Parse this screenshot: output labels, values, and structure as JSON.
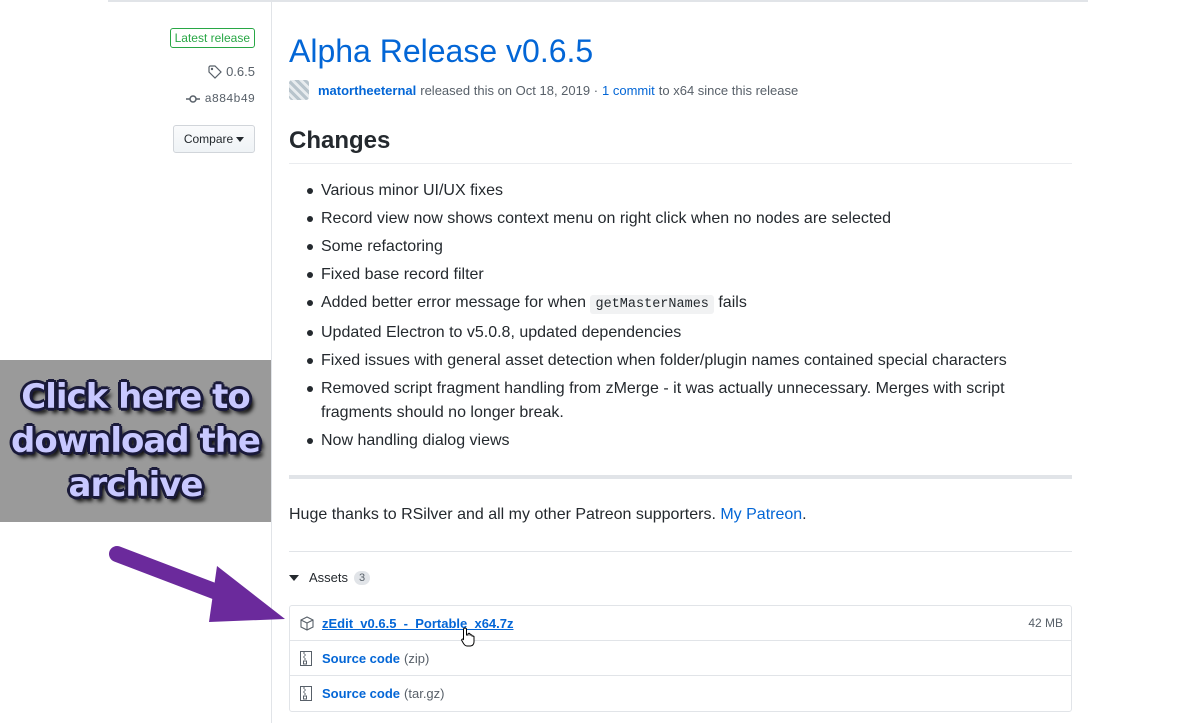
{
  "sidebar": {
    "badge": "Latest release",
    "tag": "0.6.5",
    "commit": "a884b49",
    "compare_label": "Compare"
  },
  "release": {
    "title": "Alpha Release v0.6.5",
    "author": "matortheeternal",
    "released_text": "released this on Oct 18, 2019 ·",
    "commits_link": "1 commit",
    "since_text": "to x64 since this release"
  },
  "changes": {
    "heading": "Changes",
    "items": [
      {
        "text": "Various minor UI/UX fixes"
      },
      {
        "text": "Record view now shows context menu on right click when no nodes are selected"
      },
      {
        "text": "Some refactoring"
      },
      {
        "text": "Fixed base record filter"
      },
      {
        "pre": "Added better error message for when",
        "code": "getMasterNames",
        "post": "fails"
      },
      {
        "text": "Updated Electron to v5.0.8, updated dependencies"
      },
      {
        "text": "Fixed issues with general asset detection when folder/plugin names contained special characters"
      },
      {
        "text": "Removed script fragment handling from zMerge - it was actually unnecessary. Merges with script fragments should no longer break."
      },
      {
        "text": "Now handling dialog views"
      }
    ]
  },
  "thanks": {
    "text": "Huge thanks to RSilver and all my other Patreon supporters.",
    "link": "My Patreon",
    "suffix": "."
  },
  "assets": {
    "label": "Assets",
    "count": "3",
    "items": [
      {
        "name": "zEdit_v0.6.5_-_Portable_x64.7z",
        "size": "42 MB",
        "icon": "package-icon"
      },
      {
        "name": "Source code",
        "format": "(zip)",
        "icon": "file-zip-icon"
      },
      {
        "name": "Source code",
        "format": "(tar.gz)",
        "icon": "file-zip-icon"
      }
    ]
  },
  "overlay": {
    "line1": "Click here to",
    "line2": "download the",
    "line3": "archive"
  },
  "colors": {
    "link": "#0366d6",
    "badge": "#28a745",
    "arrow": "#6b2a9c",
    "overlay_bg": "#9a9a9a"
  }
}
